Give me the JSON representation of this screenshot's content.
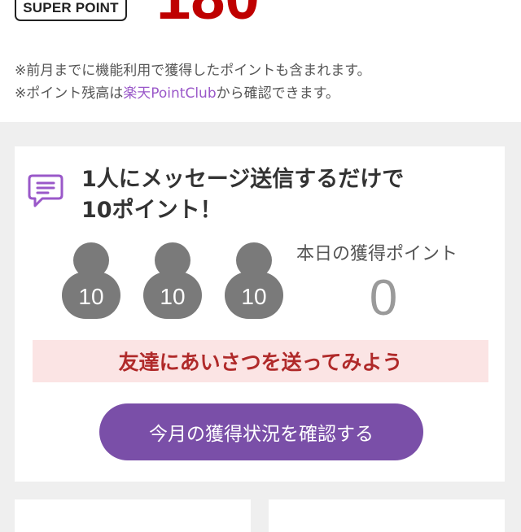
{
  "header": {
    "badge_label": "SUPER POINT",
    "points_value": "180",
    "note_line1": "※前月までに機能利用で獲得したポイントも含まれます。",
    "note_line2_prefix": "※ポイント残高は",
    "note_line2_link": "楽天PointClub",
    "note_line2_suffix": "から確認できます。"
  },
  "campaign": {
    "icon": "chat-bubble-icon",
    "headline_line1": "1人にメッセージ送信するだけで",
    "headline_line2": "10ポイント！",
    "slots": [
      {
        "icon": "person-icon",
        "points": "10"
      },
      {
        "icon": "person-icon",
        "points": "10"
      },
      {
        "icon": "person-icon",
        "points": "10"
      }
    ],
    "today_label": "本日の獲得ポイント",
    "today_value": "0",
    "banner_text": "友達にあいさつを送ってみよう",
    "cta_label": "今月の獲得状況を確認する"
  },
  "colors": {
    "brand_red": "#bf0000",
    "cta_purple": "#7a4fa8",
    "link_purple": "#9a58c9",
    "banner_bg": "#fbe4e4"
  }
}
